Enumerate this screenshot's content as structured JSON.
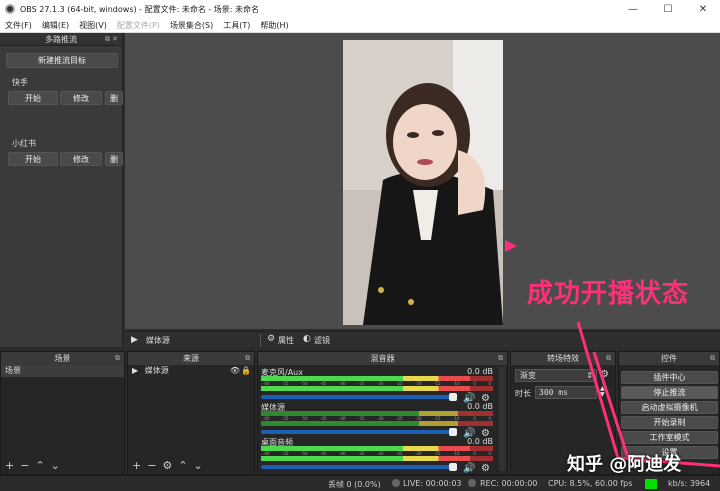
{
  "window": {
    "title": "OBS 27.1.3 (64-bit, windows) - 配置文件: 未命名 - 场景: 未命名",
    "min": "—",
    "max": "☐",
    "close": "✕"
  },
  "menu": [
    "文件(F)",
    "编辑(E)",
    "视图(V)",
    "配置文件(P)",
    "场景集合(S)",
    "工具(T)",
    "帮助(H)"
  ],
  "multistream": {
    "title": "多路推流",
    "new_target": "新建推流目标",
    "targets": [
      {
        "name": "快手",
        "start": "开始",
        "edit": "修改",
        "more": "删"
      },
      {
        "name": "小红书",
        "start": "开始",
        "edit": "修改",
        "more": "删"
      }
    ]
  },
  "annotation": "成功开播状态",
  "watermark": "知乎 @阿迪发",
  "context_bar": {
    "source": "媒体源",
    "properties": "属性",
    "filters": "滤镜"
  },
  "scenes": {
    "title": "场景",
    "items": [
      "场景"
    ]
  },
  "sources": {
    "title": "来源",
    "items": [
      "媒体源"
    ]
  },
  "mixer": {
    "title": "混音器",
    "channels": [
      {
        "name": "麦克风/Aux",
        "db": "0.0 dB",
        "level": 0.9
      },
      {
        "name": "媒体源",
        "db": "0.0 dB",
        "level": 0.0
      },
      {
        "name": "桌面音频",
        "db": "0.0 dB",
        "level": 0.9
      }
    ],
    "ticks": [
      "-60",
      "-55",
      "-50",
      "-45",
      "-40",
      "-35",
      "-30",
      "-25",
      "-20",
      "-15",
      "-10",
      "-5",
      "0"
    ]
  },
  "transitions": {
    "title": "转场特效",
    "type": "渐变",
    "duration_label": "时长",
    "duration": "300 ms"
  },
  "controls": {
    "title": "控件",
    "buttons": [
      "插件中心",
      "停止推流",
      "启动虚拟摄像机",
      "开始录制",
      "工作室模式",
      "设置"
    ]
  },
  "status": {
    "dropped": "丢帧 0 (0.0%)",
    "live": "LIVE: 00:00:03",
    "rec": "REC: 00:00:00",
    "cpu": "CPU: 8.5%, 60.00 fps",
    "kbs": "kb/s: 3964"
  },
  "colors": {
    "accent": "#ff2f7a",
    "status_ok": "#00e000"
  }
}
